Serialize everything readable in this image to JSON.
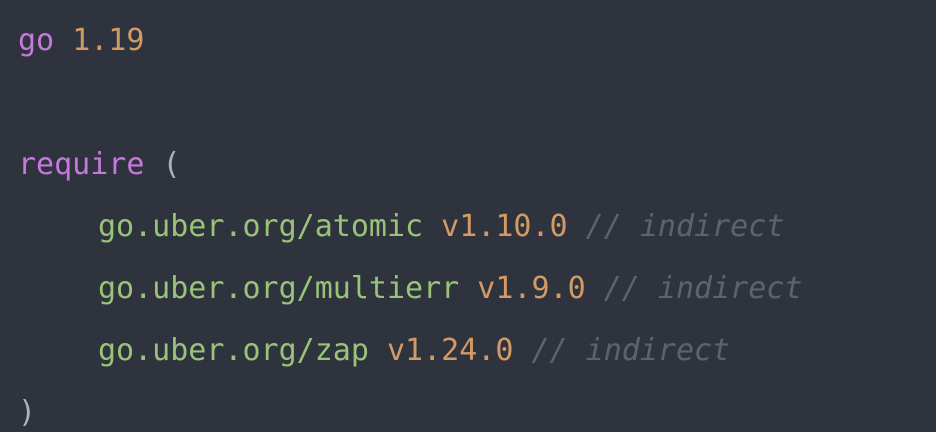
{
  "code": {
    "lines": [
      {
        "keyword": "go",
        "version": "1.19"
      },
      {},
      {
        "keyword": "require",
        "open_paren": "("
      },
      {
        "module": "go.uber.org/atomic",
        "version": "v1.10.0",
        "comment": "// indirect"
      },
      {
        "module": "go.uber.org/multierr",
        "version": "v1.9.0",
        "comment": "// indirect"
      },
      {
        "module": "go.uber.org/zap",
        "version": "v1.24.0",
        "comment": "// indirect"
      },
      {
        "close_paren": ")"
      }
    ]
  },
  "colors": {
    "background": "#2f333d",
    "keyword": "#c678dd",
    "number": "#d19a66",
    "module_path": "#98c379",
    "comment": "#5c6370",
    "punctuation": "#abb2bf"
  }
}
